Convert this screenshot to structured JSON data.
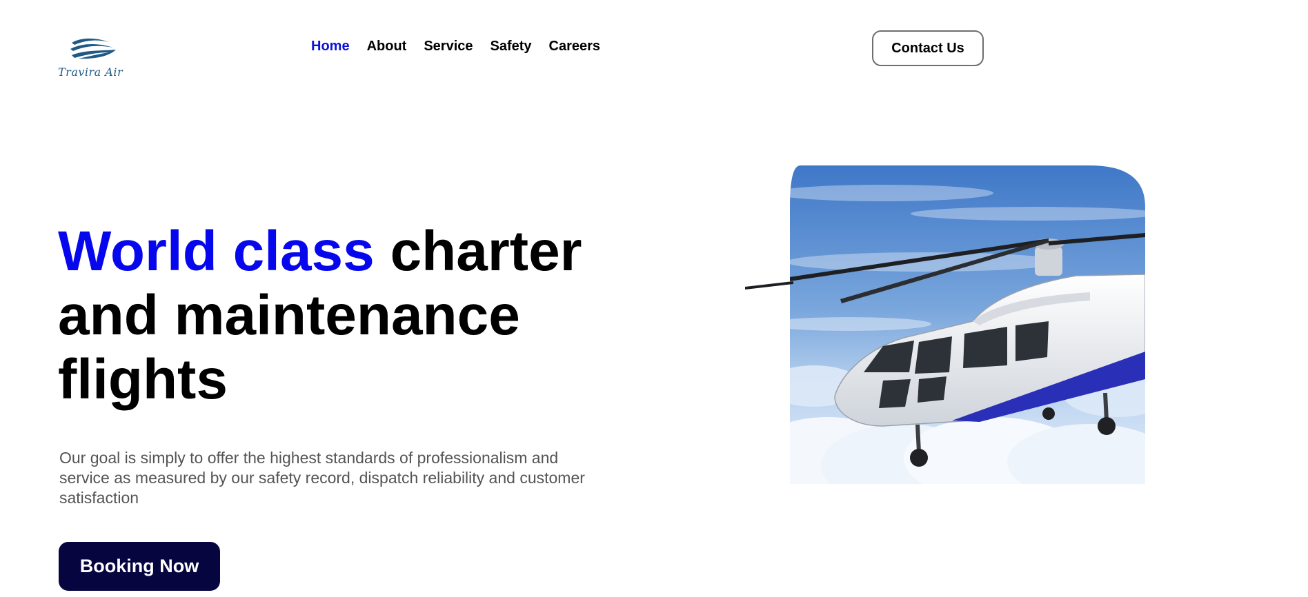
{
  "brand": {
    "name": "Travira Air"
  },
  "nav": {
    "items": [
      {
        "label": "Home",
        "active": true
      },
      {
        "label": "About",
        "active": false
      },
      {
        "label": "Service",
        "active": false
      },
      {
        "label": "Safety",
        "active": false
      },
      {
        "label": "Careers",
        "active": false
      }
    ]
  },
  "header": {
    "contact_label": "Contact Us"
  },
  "hero": {
    "title_accent": "World class",
    "title_rest": " charter and maintenance flights",
    "description": "Our goal is simply to offer the highest standards of professionalism and service as measured by our safety record, dispatch reliability and customer satisfaction",
    "cta_label": "Booking Now"
  },
  "colors": {
    "accent": "#0707ee",
    "nav_active": "#0d12d6",
    "cta_background": "#070540",
    "logo": "#1d5a86"
  },
  "icons": {
    "logo_mark": "wave-logo-icon",
    "hero_image": "helicopter-in-clouds"
  }
}
